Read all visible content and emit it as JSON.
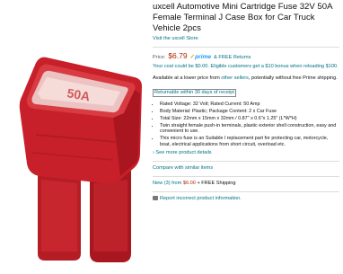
{
  "product": {
    "title": "uxcell Automotive Mini Cartridge Fuse 32V 50A Female Terminal J Case Box for Car Truck Vehicle 2pcs",
    "store_link": "Visit the uxcell Store",
    "price_label": "Price:",
    "price": "$6.79",
    "prime": "prime",
    "returns": "& FREE Returns",
    "bonus": "Your cost could be $0.00. Eligible customers get a $10 bonus when reloading $100.",
    "avail_prefix": "Available at a lower price from ",
    "avail_link": "other sellers",
    "avail_suffix": ", potentially without free Prime shipping.",
    "returnable": "Returnable within 30 days of receipt",
    "fuse_label": "50A",
    "bullets": [
      "Rated Voltage: 32 Volt; Rated Current: 50 Amp",
      "Body Material: Plastic; Package Content: 2 x Car Fuse",
      "Total Size: 22mm x 15mm x 32mm / 0.87\" x 0.6\"x 1.25\" (L*W*H)",
      "Twin straight female push-in terminals, plastic exterior shell construction, easy and convenient to use.",
      "This micro fuse is an Suitable l replacement part for protecting car, motorcycle, boat, electrical applications from short circuit, overload etc."
    ],
    "see_more": "› See more product details",
    "compare": "Compare with similar items",
    "used_prefix": "New (3) from ",
    "used_price": "$6.00",
    "used_suffix": " + FREE Shipping",
    "report": "Report incorrect product information."
  },
  "colors": {
    "fuse_red": "#c8202a",
    "link": "#007185",
    "price": "#b12704",
    "prime": "#1a98ff"
  }
}
